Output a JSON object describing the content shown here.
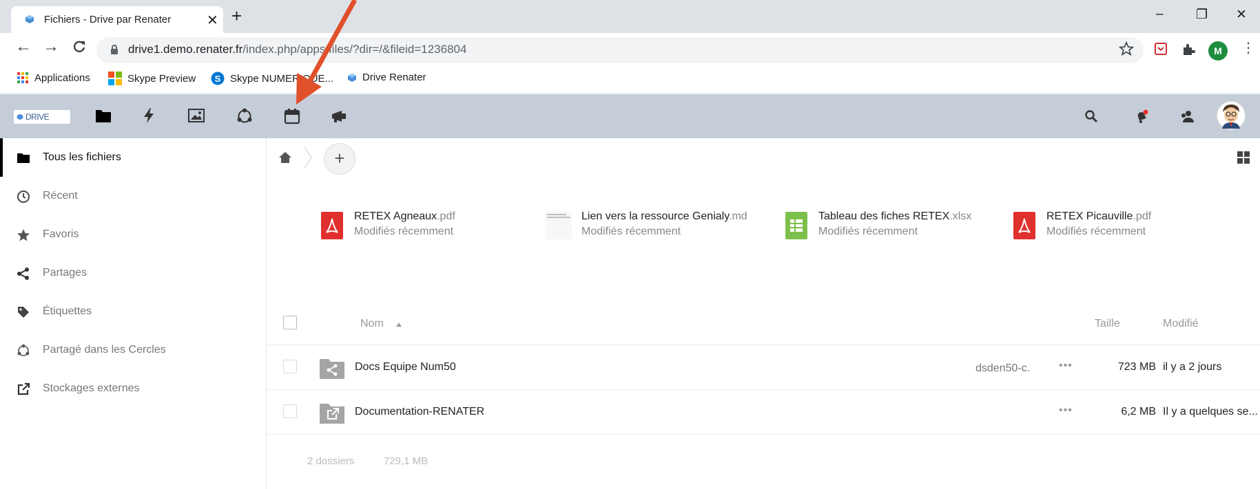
{
  "browser": {
    "tab_title": "Fichiers - Drive par Renater",
    "tab_close": "✕",
    "new_tab": "+",
    "window_controls": {
      "minimize": "–",
      "restore": "❐",
      "close": "✕"
    },
    "nav": {
      "back": "←",
      "forward": "→",
      "reload": "C"
    },
    "url_host": "drive1.demo.renater.fr",
    "url_path": "/index.php/apps/files/?dir=/&fileid=1236804",
    "profile_initial": "M",
    "bookmarks": [
      "Applications",
      "Skype Preview",
      "Skype NUMERIQUE...",
      "Drive Renater"
    ]
  },
  "app": {
    "logo_text": "DRIVE",
    "header_icons": [
      "folder-icon",
      "activity-icon",
      "gallery-icon",
      "circles-icon",
      "calendar-icon",
      "announcement-icon"
    ],
    "right_icons": [
      "search-icon",
      "notifications-icon",
      "contacts-icon",
      "user-avatar"
    ]
  },
  "sidebar": {
    "items": [
      {
        "label": "Tous les fichiers",
        "icon": "folder-icon",
        "active": true
      },
      {
        "label": "Récent",
        "icon": "clock-icon",
        "active": false
      },
      {
        "label": "Favoris",
        "icon": "star-icon",
        "active": false
      },
      {
        "label": "Partages",
        "icon": "share-icon",
        "active": false
      },
      {
        "label": "Étiquettes",
        "icon": "tag-icon",
        "active": false
      },
      {
        "label": "Partagé dans les Cercles",
        "icon": "circles-icon",
        "active": false
      },
      {
        "label": "Stockages externes",
        "icon": "external-icon",
        "active": false
      }
    ]
  },
  "breadcrumb": {
    "new_button": "+"
  },
  "recent_files": [
    {
      "name": "RETEX Agneaux",
      "ext": ".pdf",
      "subtitle": "Modifiés récemment",
      "icon": "pdf-icon"
    },
    {
      "name": "Lien vers la ressource Genialy",
      "ext": ".md",
      "subtitle": "Modifiés récemment",
      "icon": "text-preview-icon"
    },
    {
      "name": "Tableau des fiches RETEX",
      "ext": ".xlsx",
      "subtitle": "Modifiés récemment",
      "icon": "spreadsheet-icon"
    },
    {
      "name": "RETEX Picauville",
      "ext": ".pdf",
      "subtitle": "Modifiés récemment",
      "icon": "pdf-icon"
    }
  ],
  "file_list": {
    "columns": {
      "name": "Nom",
      "size": "Taille",
      "modified": "Modifié"
    },
    "rows": [
      {
        "name": "Docs Equipe Num50",
        "owner": "dsden50-c.",
        "actions": "•••",
        "size": "723 MB",
        "modified": "il y a 2 jours",
        "icon": "shared-folder-icon"
      },
      {
        "name": "Documentation-RENATER",
        "owner": "",
        "actions": "•••",
        "size": "6,2 MB",
        "modified": "Il y a quelques se...",
        "icon": "external-folder-icon"
      }
    ],
    "summary": {
      "folders": "2 dossiers",
      "total_size": "729,1 MB"
    }
  },
  "colors": {
    "header_bg": "#c5cdd8",
    "pdf_red": "#e0302e",
    "sheet_green": "#7cc04b",
    "arrow": "#e0502a",
    "folder_grey": "#a5a5a5"
  }
}
